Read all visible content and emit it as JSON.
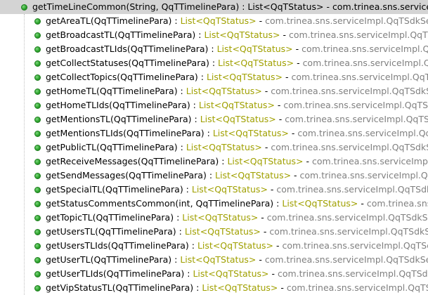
{
  "outline": {
    "parent": {
      "signature": "getTimeLineCommon(String, QqTTimelinePara)",
      "separator": " : ",
      "return_type": "List<QqTStatus>",
      "dash": " - ",
      "owner": "com.trinea.sns.serviceImpl.QqTSdkServiceImpl"
    },
    "items": [
      {
        "signature": "getAreaTL(QqTTimelinePara)",
        "separator": " : ",
        "return_type": "List<QqTStatus>",
        "dash": " - ",
        "owner": "com.trinea.sns.serviceImpl.QqTSdkServiceImpl"
      },
      {
        "signature": "getBroadcastTL(QqTTimelinePara)",
        "separator": " : ",
        "return_type": "List<QqTStatus>",
        "dash": " - ",
        "owner": "com.trinea.sns.serviceImpl.QqTSdkServiceImpl"
      },
      {
        "signature": "getBroadcastTLIds(QqTTimelinePara)",
        "separator": " : ",
        "return_type": "List<QqTStatus>",
        "dash": " - ",
        "owner": "com.trinea.sns.serviceImpl.QqTSdkServiceImpl"
      },
      {
        "signature": "getCollectStatuses(QqTTimelinePara)",
        "separator": " : ",
        "return_type": "List<QqTStatus>",
        "dash": " - ",
        "owner": "com.trinea.sns.serviceImpl.QqTSdkServiceImpl"
      },
      {
        "signature": "getCollectTopics(QqTTimelinePara)",
        "separator": " : ",
        "return_type": "List<QqTStatus>",
        "dash": " - ",
        "owner": "com.trinea.sns.serviceImpl.QqTSdkServiceImpl"
      },
      {
        "signature": "getHomeTL(QqTTimelinePara)",
        "separator": " : ",
        "return_type": "List<QqTStatus>",
        "dash": " - ",
        "owner": "com.trinea.sns.serviceImpl.QqTSdkServiceImpl"
      },
      {
        "signature": "getHomeTLIds(QqTTimelinePara)",
        "separator": " : ",
        "return_type": "List<QqTStatus>",
        "dash": " - ",
        "owner": "com.trinea.sns.serviceImpl.QqTSdkServiceImpl"
      },
      {
        "signature": "getMentionsTL(QqTTimelinePara)",
        "separator": " : ",
        "return_type": "List<QqTStatus>",
        "dash": " - ",
        "owner": "com.trinea.sns.serviceImpl.QqTSdkServiceImpl"
      },
      {
        "signature": "getMentionsTLIds(QqTTimelinePara)",
        "separator": " : ",
        "return_type": "List<QqTStatus>",
        "dash": " - ",
        "owner": "com.trinea.sns.serviceImpl.QqTSdkServiceImpl"
      },
      {
        "signature": "getPublicTL(QqTTimelinePara)",
        "separator": " : ",
        "return_type": "List<QqTStatus>",
        "dash": " - ",
        "owner": "com.trinea.sns.serviceImpl.QqTSdkServiceImpl"
      },
      {
        "signature": "getReceiveMessages(QqTTimelinePara)",
        "separator": " : ",
        "return_type": "List<QqTStatus>",
        "dash": " - ",
        "owner": "com.trinea.sns.serviceImpl.QqTSdkServiceImpl"
      },
      {
        "signature": "getSendMessages(QqTTimelinePara)",
        "separator": " : ",
        "return_type": "List<QqTStatus>",
        "dash": " - ",
        "owner": "com.trinea.sns.serviceImpl.QqTSdkServiceImpl"
      },
      {
        "signature": "getSpecialTL(QqTTimelinePara)",
        "separator": " : ",
        "return_type": "List<QqTStatus>",
        "dash": " - ",
        "owner": "com.trinea.sns.serviceImpl.QqTSdkServiceImpl"
      },
      {
        "signature": "getStatusCommentsCommon(int, QqTTimelinePara)",
        "separator": " : ",
        "return_type": "List<QqTStatus>",
        "dash": " - ",
        "owner": "com.trinea.sns.serviceImpl.QqTSdkServiceImpl"
      },
      {
        "signature": "getTopicTL(QqTTimelinePara)",
        "separator": " : ",
        "return_type": "List<QqTStatus>",
        "dash": " - ",
        "owner": "com.trinea.sns.serviceImpl.QqTSdkServiceImpl"
      },
      {
        "signature": "getUsersTL(QqTTimelinePara)",
        "separator": " : ",
        "return_type": "List<QqTStatus>",
        "dash": " - ",
        "owner": "com.trinea.sns.serviceImpl.QqTSdkServiceImpl"
      },
      {
        "signature": "getUsersTLIds(QqTTimelinePara)",
        "separator": " : ",
        "return_type": "List<QqTStatus>",
        "dash": " - ",
        "owner": "com.trinea.sns.serviceImpl.QqTSdkServiceImpl"
      },
      {
        "signature": "getUserTL(QqTTimelinePara)",
        "separator": " : ",
        "return_type": "List<QqTStatus>",
        "dash": " - ",
        "owner": "com.trinea.sns.serviceImpl.QqTSdkServiceImpl"
      },
      {
        "signature": "getUserTLIds(QqTTimelinePara)",
        "separator": " : ",
        "return_type": "List<QqTStatus>",
        "dash": " - ",
        "owner": "com.trinea.sns.serviceImpl.QqTSdkServiceImpl"
      },
      {
        "signature": "getVipStatusTL(QqTTimelinePara)",
        "separator": " : ",
        "return_type": "List<QqTStatus>",
        "dash": " - ",
        "owner": "com.trinea.sns.serviceImpl.QqTSdkServiceImpl"
      }
    ],
    "icon": "public-method-icon",
    "colors": {
      "return_type": "#a0a000",
      "owner": "#808080",
      "method_icon": "#2fa52f",
      "selection": "#d4d4d4"
    }
  }
}
